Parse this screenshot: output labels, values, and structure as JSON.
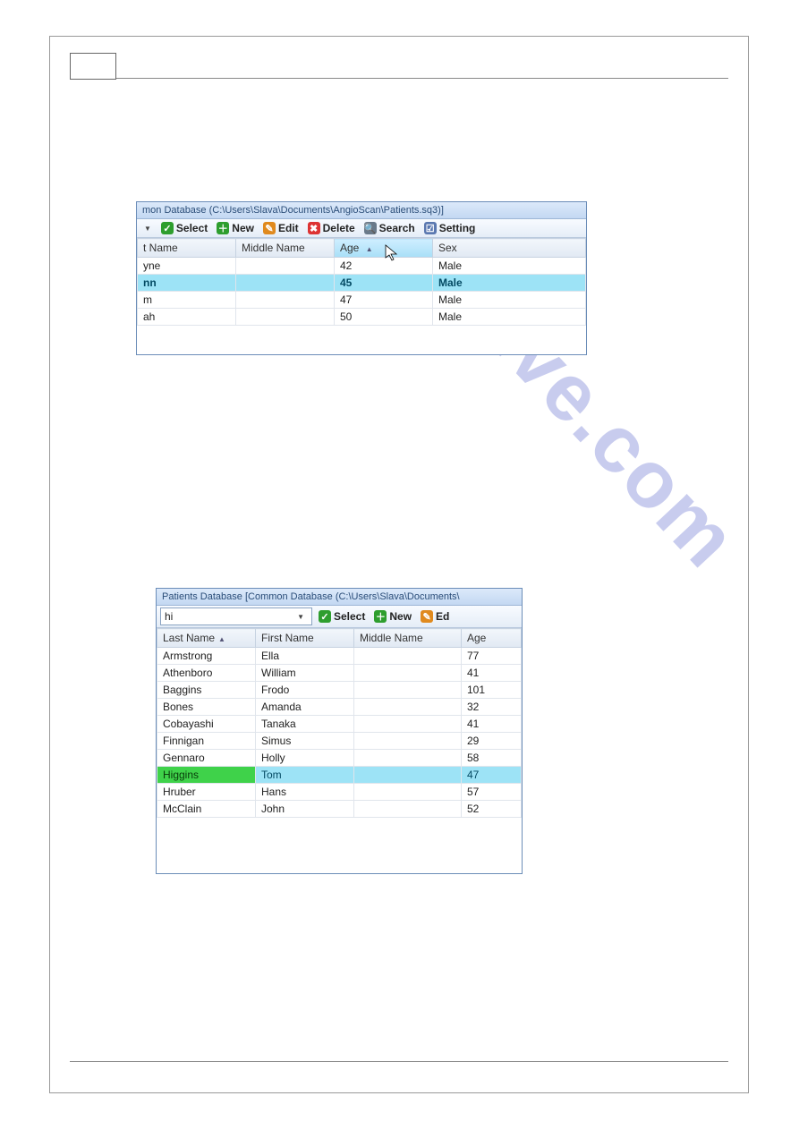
{
  "watermark": "hive.com",
  "shot1": {
    "titlebar": "mon Database (C:\\Users\\Slava\\Documents\\AngioScan\\Patients.sq3)]",
    "toolbar": {
      "select": "Select",
      "new": "New",
      "edit": "Edit",
      "delete": "Delete",
      "search": "Search",
      "settings": "Setting"
    },
    "columns": [
      "t Name",
      "Middle Name",
      "Age",
      "Sex"
    ],
    "sort_column_index": 2,
    "selected_index": 1,
    "rows": [
      {
        "name": "yne",
        "middle": "",
        "age": "42",
        "sex": "Male"
      },
      {
        "name": "nn",
        "middle": "",
        "age": "45",
        "sex": "Male"
      },
      {
        "name": "m",
        "middle": "",
        "age": "47",
        "sex": "Male"
      },
      {
        "name": "ah",
        "middle": "",
        "age": "50",
        "sex": "Male"
      }
    ]
  },
  "shot2": {
    "titlebar": "Patients Database [Common Database (C:\\Users\\Slava\\Documents\\",
    "search_value": "hi",
    "toolbar": {
      "select": "Select",
      "new": "New",
      "edit": "Ed"
    },
    "columns": [
      "Last Name",
      "First Name",
      "Middle Name",
      "Age"
    ],
    "highlight_index": 7,
    "hit_column_index": 0,
    "rows": [
      {
        "last": "Armstrong",
        "first": "Ella",
        "middle": "",
        "age": "77"
      },
      {
        "last": "Athenboro",
        "first": "William",
        "middle": "",
        "age": "41"
      },
      {
        "last": "Baggins",
        "first": "Frodo",
        "middle": "",
        "age": "101"
      },
      {
        "last": "Bones",
        "first": "Amanda",
        "middle": "",
        "age": "32"
      },
      {
        "last": "Cobayashi",
        "first": "Tanaka",
        "middle": "",
        "age": "41"
      },
      {
        "last": "Finnigan",
        "first": "Simus",
        "middle": "",
        "age": "29"
      },
      {
        "last": "Gennaro",
        "first": "Holly",
        "middle": "",
        "age": "58"
      },
      {
        "last": "Higgins",
        "first": "Tom",
        "middle": "",
        "age": "47"
      },
      {
        "last": "Hruber",
        "first": "Hans",
        "middle": "",
        "age": "57"
      },
      {
        "last": "McClain",
        "first": "John",
        "middle": "",
        "age": "52"
      }
    ]
  }
}
